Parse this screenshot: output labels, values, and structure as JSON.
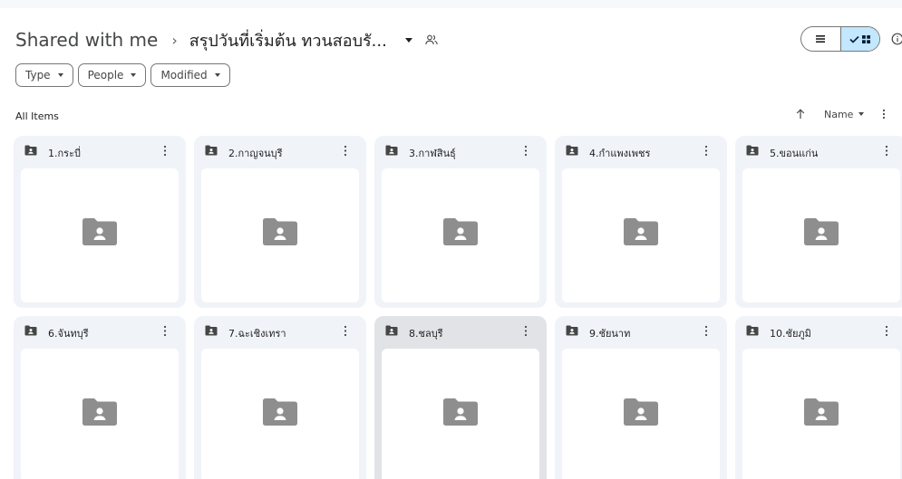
{
  "breadcrumb": {
    "root": "Shared with me",
    "separator": "›",
    "current": "สรุปวันที่เริ่มต้น ทวนสอบรั..."
  },
  "view_toggle": {
    "list_icon": "list-view-icon",
    "grid_icon": "grid-view-icon",
    "selected": "grid"
  },
  "filters": [
    {
      "label": "Type"
    },
    {
      "label": "People"
    },
    {
      "label": "Modified"
    }
  ],
  "section": {
    "label": "All Items"
  },
  "sort": {
    "label": "Name"
  },
  "folders": [
    {
      "name": "1.กระบี่"
    },
    {
      "name": "2.กาญจนบุรี"
    },
    {
      "name": "3.กาฬสินธุ์"
    },
    {
      "name": "4.กำแพงเพชร"
    },
    {
      "name": "5.ขอนแก่น"
    },
    {
      "name": "6.จันทบุรี"
    },
    {
      "name": "7.ฉะเชิงเทรา"
    },
    {
      "name": "8.ชลบุรี"
    },
    {
      "name": "9.ชัยนาท"
    },
    {
      "name": "10.ชัยภูมิ"
    }
  ],
  "colors": {
    "card_bg": "#f0f4f9",
    "card_selected_bg": "#e1e3e6",
    "toggle_active": "#c2e7ff",
    "folder_icon": "#444746",
    "thumb_icon": "#8e8e8e"
  }
}
